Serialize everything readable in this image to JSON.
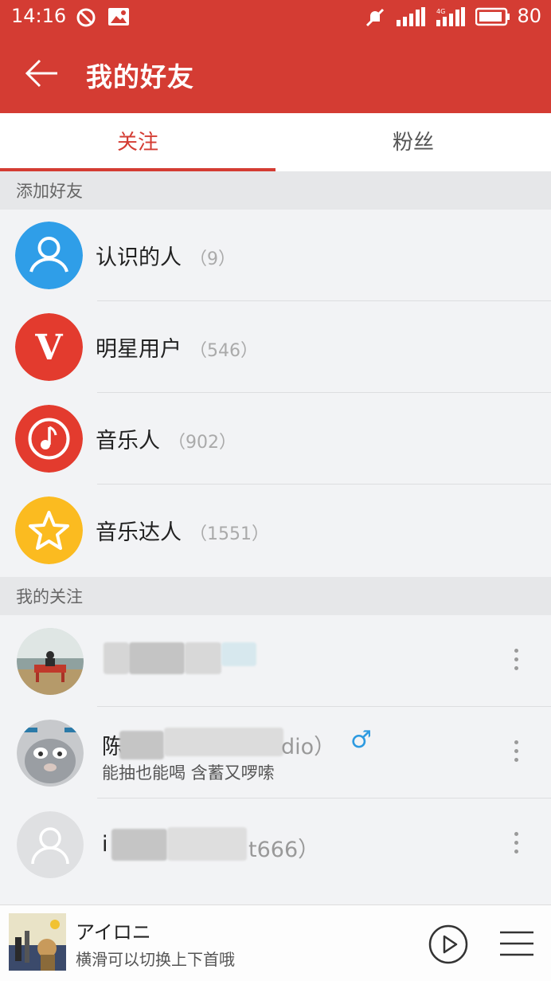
{
  "status": {
    "time": "14:16",
    "battery": "80"
  },
  "header": {
    "title": "我的好友"
  },
  "tabs": [
    {
      "label": "关注"
    },
    {
      "label": "粉丝"
    }
  ],
  "sections": {
    "add_friends": "添加好友",
    "following": "我的关注"
  },
  "add_items": [
    {
      "label": "认识的人",
      "count": "（9）",
      "icon": "person-icon",
      "color": "#2f9ee8"
    },
    {
      "label": "明星用户",
      "count": "（546）",
      "icon": "v-icon",
      "color": "#e33b2e"
    },
    {
      "label": "音乐人",
      "count": "（902）",
      "icon": "music-note-icon",
      "color": "#e33b2e"
    },
    {
      "label": "音乐达人",
      "count": "（1551）",
      "icon": "star-icon",
      "color": "#fbbb20"
    }
  ],
  "friends": [
    {
      "name_visible": "",
      "sub": ""
    },
    {
      "name_visible": "陈",
      "name_tail": "dio）",
      "gender": "♂",
      "sub": "能抽也能喝 含蓄又啰嗦"
    },
    {
      "name_visible": "i",
      "name_tail": "t666）",
      "sub": ""
    }
  ],
  "player": {
    "song": "アイロニ",
    "hint": "横滑可以切换上下首哦"
  },
  "colors": {
    "accent": "#d43c33",
    "male": "#2d9ae0"
  }
}
